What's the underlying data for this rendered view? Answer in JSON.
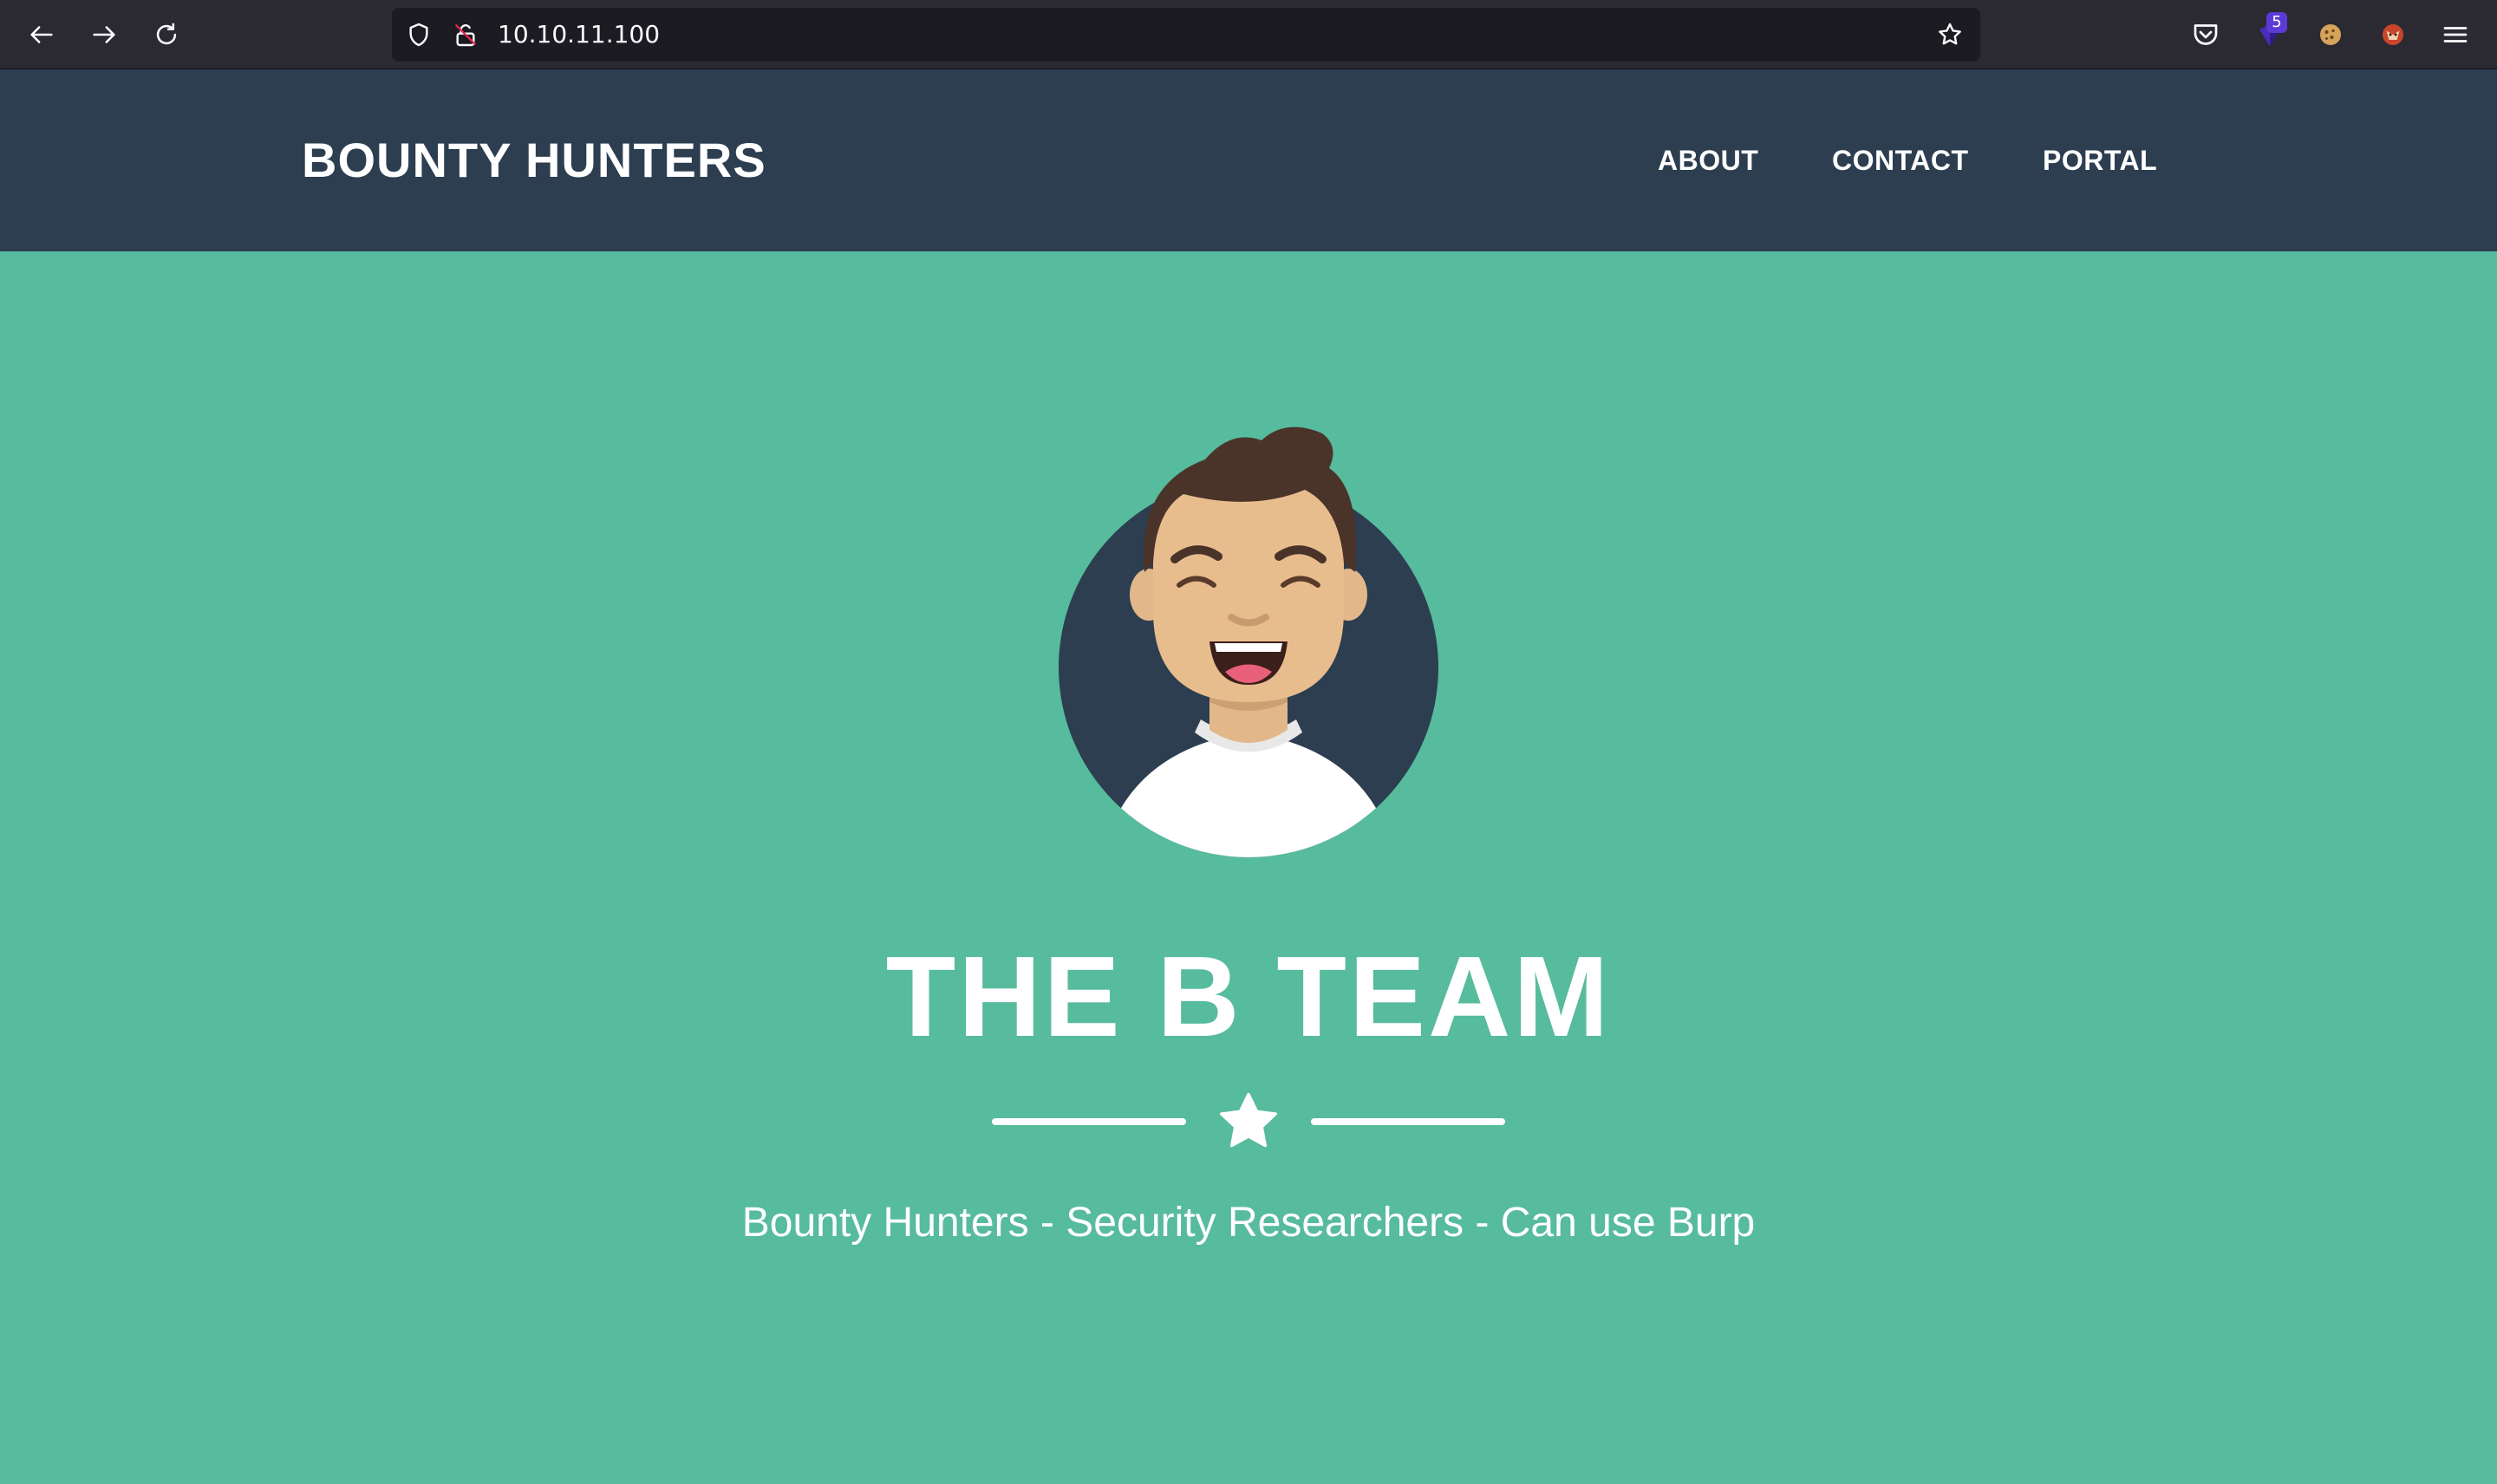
{
  "browser": {
    "url": "10.10.11.100",
    "extension_badge_count": "5",
    "icons": {
      "back": "arrow-left-icon",
      "forward": "arrow-right-icon",
      "reload": "reload-icon",
      "tracking_protection": "shield-icon",
      "connection": "insecure-lock-icon",
      "bookmark": "star-outline-icon",
      "pocket": "pocket-icon",
      "extension_1": "extension-shield-icon",
      "cookie": "cookie-icon",
      "extension_3": "extension-fox-icon",
      "menu": "hamburger-menu-icon"
    },
    "colors": {
      "chrome_bg": "#2b2a33",
      "urlbar_bg": "#1c1b22",
      "badge_bg": "#5b3bd6"
    }
  },
  "site": {
    "brand": "BOUNTY HUNTERS",
    "nav": {
      "items": [
        {
          "label": "ABOUT"
        },
        {
          "label": "CONTACT"
        },
        {
          "label": "PORTAL"
        }
      ]
    },
    "masthead": {
      "title": "THE B TEAM",
      "subtitle": "Bounty Hunters - Security Researchers - Can use Burp",
      "avatar_icon": "avatar-illustration",
      "divider_icon": "star-icon"
    },
    "colors": {
      "nav_bg": "#2c3e50",
      "masthead_bg": "#57bb9d",
      "text": "#ffffff"
    }
  }
}
